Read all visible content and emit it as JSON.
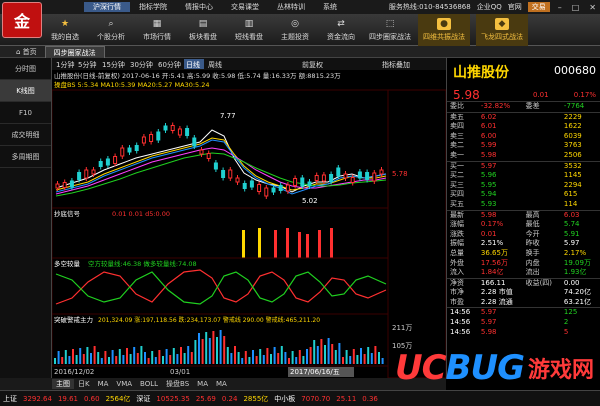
{
  "menu": [
    "沪深行情",
    "指标学院",
    "情报中心",
    "交易课堂",
    "丛林特训",
    "系统"
  ],
  "top_right": {
    "service": "服务热线:010-84536868",
    "account": "企业QQ",
    "site": "官网",
    "trade": "交易"
  },
  "toolbar": [
    {
      "label": "我的自选",
      "icon": "star-icon"
    },
    {
      "label": "个股分析",
      "icon": "search-icon"
    },
    {
      "label": "市场行情",
      "icon": "grid-icon"
    },
    {
      "label": "板块看盘",
      "icon": "blocks-icon"
    },
    {
      "label": "短线看盘",
      "icon": "chart-icon"
    },
    {
      "label": "主题投资",
      "icon": "target-icon"
    },
    {
      "label": "资金流向",
      "icon": "flow-icon"
    },
    {
      "label": "四步圈家战法",
      "icon": "step-icon"
    },
    {
      "label": "四维共振战法",
      "icon": "resonance-icon"
    },
    {
      "label": "飞龙四式战法",
      "icon": "dragon-icon"
    }
  ],
  "tabs": [
    "首页",
    "四步圈家战法"
  ],
  "side_nav": [
    "分时图",
    "K线图",
    "F10",
    "成交明细",
    "多周期图"
  ],
  "chart": {
    "periods": [
      "1分钟",
      "5分钟",
      "15分钟",
      "30分钟",
      "60分钟",
      "日线",
      "周线"
    ],
    "fq": "前复权",
    "indicator": "指标叠加",
    "info_line": "山推股份(日线-前复权) 2017-06-16 开:5.41 高:5.99 收:5.98 低:5.74 量:16.33万 额:8815.23万",
    "ma_line": "操盘BS 5:5.34 MA10:5.39 MA20:5.27 MA30:5.24",
    "sub1_label": "抄底信号",
    "sub1_values": "0.01 0.01 d5:0.00",
    "sub2_label": "多空较量",
    "sub2_values": "空方较量线:46.38  做多较量线:74.08",
    "sub3_label": "突破警戒主力",
    "sub3_values": "201,324.09 涨:197,118.56 跌:234,173.07 警戒线 290.00 警戒线:465,211.20",
    "annotations": {
      "high": "7.77",
      "low": "5.02",
      "last": "5.78"
    },
    "dates": [
      "2016/12/02",
      "03/01",
      "06/16"
    ],
    "cursor_date": "2017/06/16/五",
    "volume_ticks": [
      "211万",
      "105万"
    ]
  },
  "stock": {
    "name": "山推股份",
    "code": "000680",
    "price": "5.98",
    "change": "0.01",
    "pct": "0.17%",
    "weibi": "-32.82%",
    "weicha": "-7764",
    "sells": [
      {
        "label": "卖五",
        "price": "6.02",
        "vol": "2229"
      },
      {
        "label": "卖四",
        "price": "6.01",
        "vol": "1622"
      },
      {
        "label": "卖三",
        "price": "6.00",
        "vol": "6039"
      },
      {
        "label": "卖二",
        "price": "5.99",
        "vol": "3763"
      },
      {
        "label": "卖一",
        "price": "5.98",
        "vol": "2506"
      }
    ],
    "buys": [
      {
        "label": "买一",
        "price": "5.97",
        "vol": "3532"
      },
      {
        "label": "买二",
        "price": "5.96",
        "vol": "1145"
      },
      {
        "label": "买三",
        "price": "5.95",
        "vol": "2294"
      },
      {
        "label": "买四",
        "price": "5.94",
        "vol": "615"
      },
      {
        "label": "买五",
        "price": "5.93",
        "vol": "114"
      }
    ],
    "stats": [
      {
        "l1": "最新",
        "v1": "5.98",
        "l2": "最高",
        "v2": "6.03"
      },
      {
        "l1": "涨幅",
        "v1": "0.17%",
        "l2": "最低",
        "v2": "5.74"
      },
      {
        "l1": "涨跌",
        "v1": "0.01",
        "l2": "今开",
        "v2": "5.91"
      },
      {
        "l1": "振幅",
        "v1": "2.51%",
        "l2": "昨收",
        "v2": "5.97"
      },
      {
        "l1": "总量",
        "v1": "36.65万",
        "l2": "换手",
        "v2": "2.17%"
      },
      {
        "l1": "外盘",
        "v1": "17.56万",
        "l2": "内盘",
        "v2": "19.09万"
      },
      {
        "l1": "流入",
        "v1": "1.84亿",
        "l2": "流出",
        "v2": "1.93亿"
      }
    ],
    "fund": [
      {
        "l1": "净资",
        "v1": "166.11",
        "l2": "收益(四)",
        "v2": "0.00"
      },
      {
        "l1": "市净",
        "v1": "2.28 市值",
        "l2": "",
        "v2": "74.20亿"
      },
      {
        "l1": "市盈",
        "v1": "2.28 流通",
        "l2": "",
        "v2": "63.21亿"
      }
    ],
    "ticks": [
      {
        "t": "14:56",
        "p": "5.97",
        "v": "125"
      },
      {
        "t": "14:56",
        "p": "5.97",
        "v": "2"
      },
      {
        "t": "14:56",
        "p": "5.98",
        "v": "5"
      }
    ]
  },
  "bottom_tabs": [
    "主图",
    "日K",
    "MA",
    "VMA",
    "BOLL",
    "操盘BS",
    "MA",
    "MA"
  ],
  "status": {
    "sh": "上证",
    "sh_v": "3292.64",
    "sh_c": "19.61",
    "sh_p": "0.60",
    "sh_a": "2564亿",
    "sz": "深证",
    "sz_v": "10525.35",
    "sz_c": "25.69",
    "sz_p": "0.24",
    "sz_a": "2855亿",
    "zx": "中小板",
    "zx_v": "7070.70",
    "zx_c": "25.11",
    "zx_p": "0.36"
  },
  "watermark": {
    "u": "UC",
    "b": "BUG",
    "d": "游戏网"
  }
}
